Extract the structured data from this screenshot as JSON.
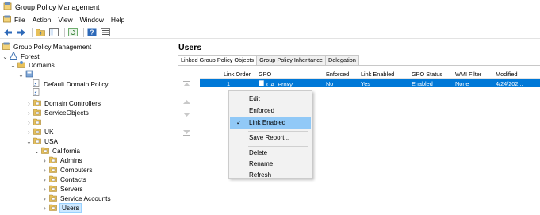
{
  "window": {
    "title": "Group Policy Management"
  },
  "menu": [
    "File",
    "Action",
    "View",
    "Window",
    "Help"
  ],
  "tree": {
    "root": "Group Policy Management",
    "forest": "Forest",
    "domains": "Domains",
    "default_policy": "Default Domain Policy",
    "domain_controllers": "Domain Controllers",
    "service_objects": "ServiceObjects",
    "uk": "UK",
    "usa": "USA",
    "california": "California",
    "admins": "Admins",
    "computers": "Computers",
    "contacts": "Contacts",
    "servers": "Servers",
    "service_accounts": "Service Accounts",
    "users": "Users"
  },
  "details": {
    "title": "Users",
    "tabs": [
      "Linked Group Policy Objects",
      "Group Policy Inheritance",
      "Delegation"
    ],
    "columns": [
      "Link Order",
      "GPO",
      "Enforced",
      "Link Enabled",
      "GPO Status",
      "WMI Filter",
      "Modified"
    ],
    "row": {
      "link_order": "1",
      "gpo": "CA_Proxy",
      "enforced": "No",
      "link_enabled": "Yes",
      "gpo_status": "Enabled",
      "wmi_filter": "None",
      "modified": "4/24/202..."
    }
  },
  "context_menu": {
    "edit": "Edit",
    "enforced": "Enforced",
    "link_enabled": "Link Enabled",
    "check_mark": "✓",
    "save_report": "Save Report...",
    "delete": "Delete",
    "rename": "Rename",
    "refresh": "Refresh"
  },
  "colors": {
    "selection": "#0078d7",
    "folder": "#e8c15a",
    "checked_item": "#91c9f7"
  }
}
